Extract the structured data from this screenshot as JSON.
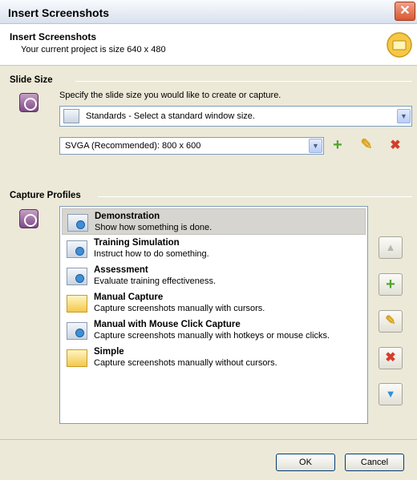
{
  "window": {
    "title": "Insert Screenshots"
  },
  "header": {
    "title": "Insert Screenshots",
    "subtitle": "Your current project is size 640 x 480",
    "icon": "folder-icon"
  },
  "slide_size": {
    "label": "Slide Size",
    "description": "Specify the slide size you would like to create or capture.",
    "standards_select": "Standards - Select a standard window size.",
    "size_select": "SVGA (Recommended): 800 x 600",
    "actions": {
      "add": "+",
      "edit": "✎",
      "delete": "✖"
    }
  },
  "capture_profiles": {
    "label": "Capture Profiles",
    "items": [
      {
        "name": "Demonstration",
        "desc": "Show how something is done.",
        "icon": "monitor-cursor-icon",
        "selected": true
      },
      {
        "name": "Training Simulation",
        "desc": "Instruct how to do something.",
        "icon": "monitor-cursor-icon",
        "selected": false
      },
      {
        "name": "Assessment",
        "desc": "Evaluate training effectiveness.",
        "icon": "monitor-cursor-icon",
        "selected": false
      },
      {
        "name": "Manual Capture",
        "desc": "Capture screenshots manually with cursors.",
        "icon": "folder-cursor-icon",
        "selected": false
      },
      {
        "name": "Manual with Mouse Click Capture",
        "desc": "Capture screenshots manually with hotkeys or mouse clicks.",
        "icon": "monitor-cursor-icon",
        "selected": false
      },
      {
        "name": "Simple",
        "desc": "Capture screenshots manually without cursors.",
        "icon": "folder-cursor-icon",
        "selected": false
      }
    ],
    "tools": {
      "up": "▲",
      "add": "+",
      "edit": "✎",
      "delete": "✖",
      "down": "▼"
    }
  },
  "buttons": {
    "ok": "OK",
    "cancel": "Cancel"
  },
  "colors": {
    "selected_row": "#d6d5d0",
    "green": "#52a52f",
    "red": "#d43d2a",
    "blue": "#2f8fda"
  }
}
